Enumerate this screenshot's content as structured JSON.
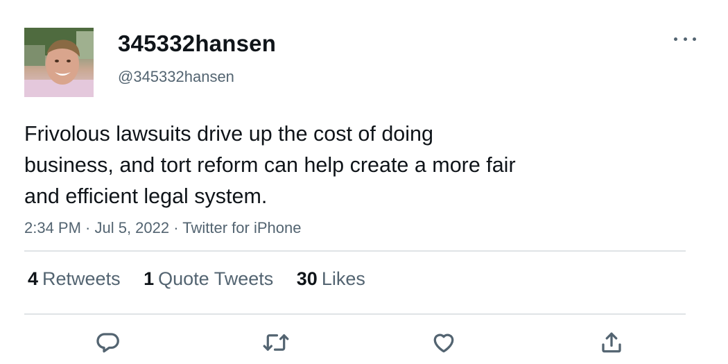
{
  "user": {
    "display_name": "345332hansen",
    "handle": "@345332hansen"
  },
  "tweet": {
    "lines": [
      "Frivolous lawsuits drive up the cost of doing",
      "business, and tort reform can help create a more fair",
      "and efficient legal system."
    ],
    "meta": "2:34 PM · Jul 5, 2022 · Twitter for iPhone"
  },
  "stats": [
    {
      "count": "4",
      "label": "Retweets"
    },
    {
      "count": "1",
      "label": "Quote Tweets"
    },
    {
      "count": "30",
      "label": "Likes"
    }
  ],
  "actions": [
    {
      "name": "reply",
      "icon": "reply-icon"
    },
    {
      "name": "retweet",
      "icon": "retweet-icon"
    },
    {
      "name": "like",
      "icon": "heart-icon"
    },
    {
      "name": "share",
      "icon": "share-icon"
    }
  ],
  "colors": {
    "text": "#0f1419",
    "secondary": "#536471",
    "divider": "#dfe3e6"
  }
}
